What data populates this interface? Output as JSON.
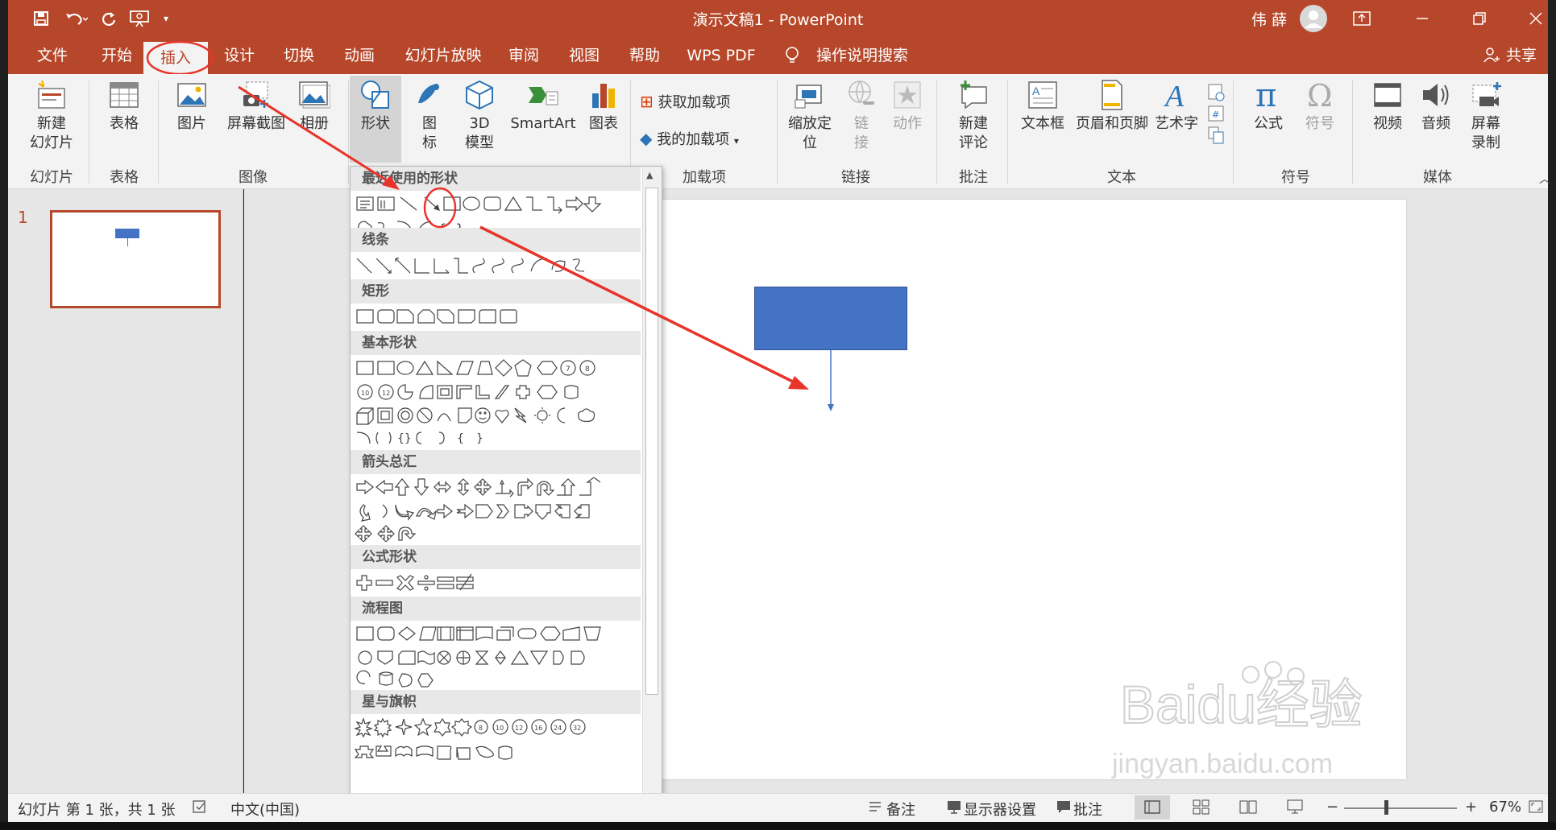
{
  "window": {
    "title": "演示文稿1  -  PowerPoint",
    "user": "伟 薛",
    "share_label": "共享"
  },
  "tabs": [
    "文件",
    "开始",
    "插入",
    "设计",
    "切换",
    "动画",
    "幻灯片放映",
    "审阅",
    "视图",
    "帮助",
    "WPS PDF",
    "操作说明搜索"
  ],
  "ribbon": {
    "new_slide": "新建\n幻灯片",
    "table": "表格",
    "picture": "图片",
    "screenshot": "屏幕截图",
    "album": "相册",
    "shapes": "形状",
    "icons": "图\n标",
    "model3d": "3D\n模型",
    "smartart": "SmartArt",
    "chart": "图表",
    "get_addins": "获取加载项",
    "my_addins": "我的加载项",
    "zoom": "缩放定\n位",
    "link": "链\n接",
    "action": "动作",
    "new_comment": "新建\n评论",
    "textbox": "文本框",
    "header_footer": "页眉和页脚",
    "wordart": "艺术字",
    "equation": "公式",
    "symbol": "符号",
    "video": "视频",
    "audio": "音频",
    "screen_record": "屏幕\n录制",
    "groups": [
      "幻灯片",
      "表格",
      "图像",
      "加载项",
      "链接",
      "批注",
      "文本",
      "符号",
      "媒体"
    ]
  },
  "gallery": {
    "categories": [
      "最近使用的形状",
      "线条",
      "矩形",
      "基本形状",
      "箭头总汇",
      "公式形状",
      "流程图",
      "星与旗帜"
    ]
  },
  "slides_pane": {
    "slide_number": "1"
  },
  "status": {
    "slide_info": "幻灯片 第 1 张，共 1 张",
    "language": "中文(中国)",
    "notes": "备注",
    "display_settings": "显示器设置",
    "comments": "批注",
    "zoom": "67%"
  },
  "watermark": {
    "brand": "Baidu经验",
    "url": "jingyan.baidu.com"
  },
  "colors": {
    "accent": "#b7472a",
    "shape_fill": "#4472c4",
    "annotation": "#e8342a"
  }
}
